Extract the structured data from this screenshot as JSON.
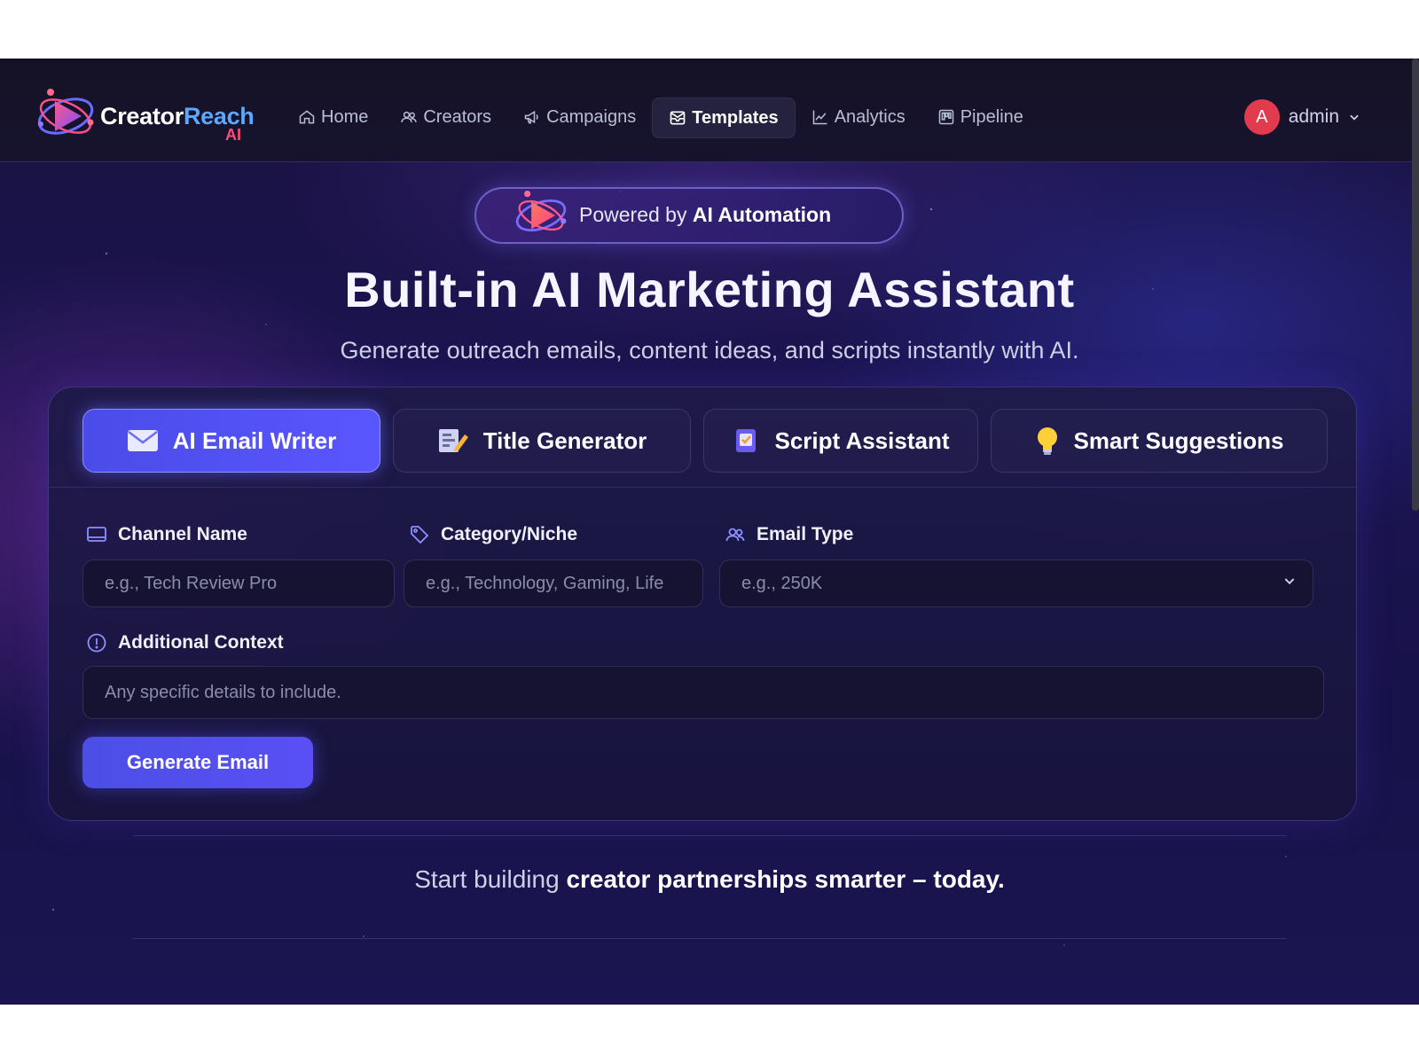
{
  "nav": {
    "logo": {
      "word1": "Creator",
      "word2": "Reach",
      "suffix": "AI"
    },
    "items": [
      {
        "label": "Home",
        "icon": "home-icon"
      },
      {
        "label": "Creators",
        "icon": "users-icon"
      },
      {
        "label": "Campaigns",
        "icon": "megaphone-icon"
      },
      {
        "label": "Templates",
        "icon": "template-icon",
        "active": true
      },
      {
        "label": "Analytics",
        "icon": "chart-icon"
      },
      {
        "label": "Pipeline",
        "icon": "pipeline-icon"
      }
    ],
    "user": {
      "initial": "A",
      "name": "admin",
      "avatar_color": "#e23b4e"
    }
  },
  "hero": {
    "badge_prefix": "Powered by",
    "badge_strong": "AI Automation",
    "title": "Built-in AI Marketing Assistant",
    "subtitle": "Generate outreach emails, content ideas, and scripts instantly with AI."
  },
  "tabs": [
    {
      "label": "AI Email Writer",
      "icon": "envelope-icon",
      "active": true
    },
    {
      "label": "Title Generator",
      "icon": "notepad-pencil-icon"
    },
    {
      "label": "Script Assistant",
      "icon": "script-icon"
    },
    {
      "label": "Smart Suggestions",
      "icon": "lightbulb-icon"
    }
  ],
  "form": {
    "channel": {
      "label": "Channel Name",
      "placeholder": "e.g., Tech Review Pro"
    },
    "category": {
      "label": "Category/Niche",
      "placeholder": "e.g., Technology, Gaming, Life"
    },
    "email_type": {
      "label": "Email Type",
      "placeholder": "e.g., 250K"
    },
    "context": {
      "label": "Additional Context",
      "placeholder": "Any specific details to include."
    },
    "submit_label": "Generate Email"
  },
  "footer": {
    "prefix": "Start building",
    "strong": "creator partnerships smarter – today."
  },
  "colors": {
    "accent": "#5a56ff",
    "brand_blue": "#5aa9ff",
    "brand_pink": "#ff4a7a"
  }
}
